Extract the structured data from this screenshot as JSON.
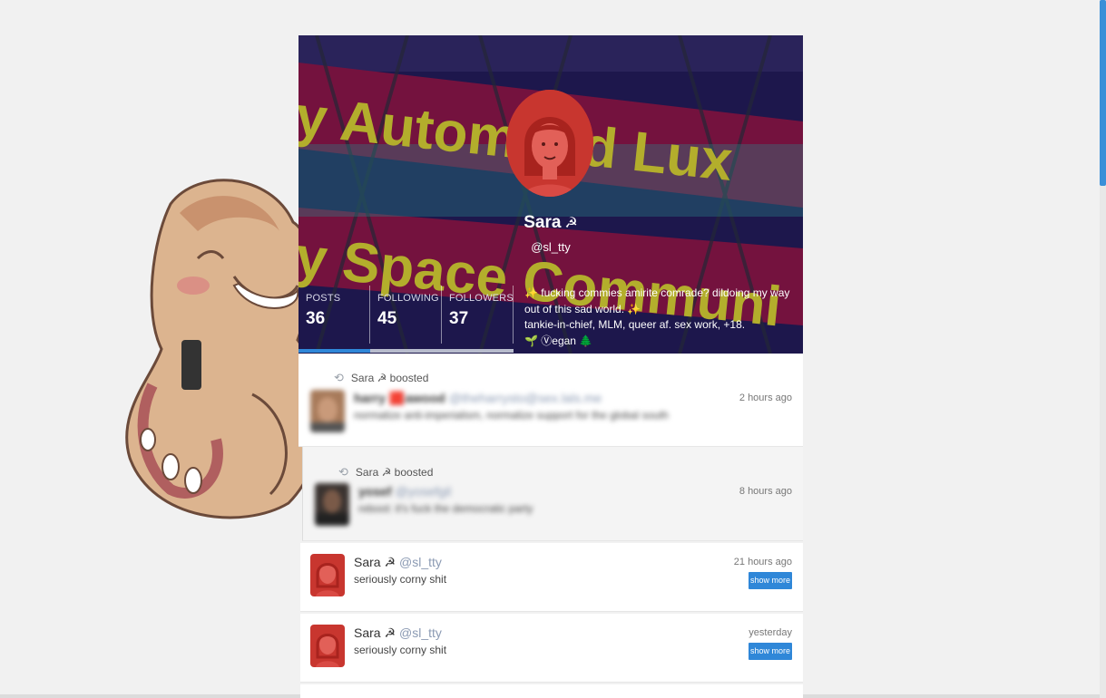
{
  "profile": {
    "display_name": "Sara",
    "name_emoji": "☭",
    "handle": "@sl_tty",
    "banner_text_line1": "y Autom  ted Lux",
    "banner_text_line2": "y Space Communi",
    "stats": [
      {
        "label": "POSTS",
        "value": "36"
      },
      {
        "label": "FOLLOWING",
        "value": "45"
      },
      {
        "label": "FOLLOWERS",
        "value": "37"
      }
    ],
    "bio_line1": "✨ fucking commies amirite comrade? dildoing my way out of this sad world. ✨",
    "bio_line2": "tankie-in-chief, MLM, queer af. sex work, +18.",
    "bio_line3": "🌱 Ⓥegan 🌲"
  },
  "feed": [
    {
      "boosted_by": "Sara ☭ boosted",
      "author": "harry 🟥awood",
      "handle": "@theharrysto@sex.lals.me",
      "text": "normalize anti-imperialism, normalize support for the global south",
      "time": "2 hours ago"
    },
    {
      "boosted_by": "Sara ☭ boosted",
      "author": "yosef",
      "handle": "@yosefgil",
      "text": "reboot: it's fuck the democratic party",
      "time": "8 hours ago"
    },
    {
      "author": "Sara ☭",
      "handle": "@sl_tty",
      "text": "seriously corny shit",
      "time": "21 hours ago",
      "button": "show more"
    },
    {
      "author": "Sara ☭",
      "handle": "@sl_tty",
      "text": "seriously corny shit",
      "time": "yesterday",
      "button": "show more"
    }
  ],
  "colors": {
    "accent": "#2f87d8",
    "avatar_red": "#c8362f",
    "banner_magenta": "#8c1544",
    "banner_yellow": "#d8d42e"
  },
  "icons": [
    "retweet-icon",
    "mascot-mammoth"
  ]
}
